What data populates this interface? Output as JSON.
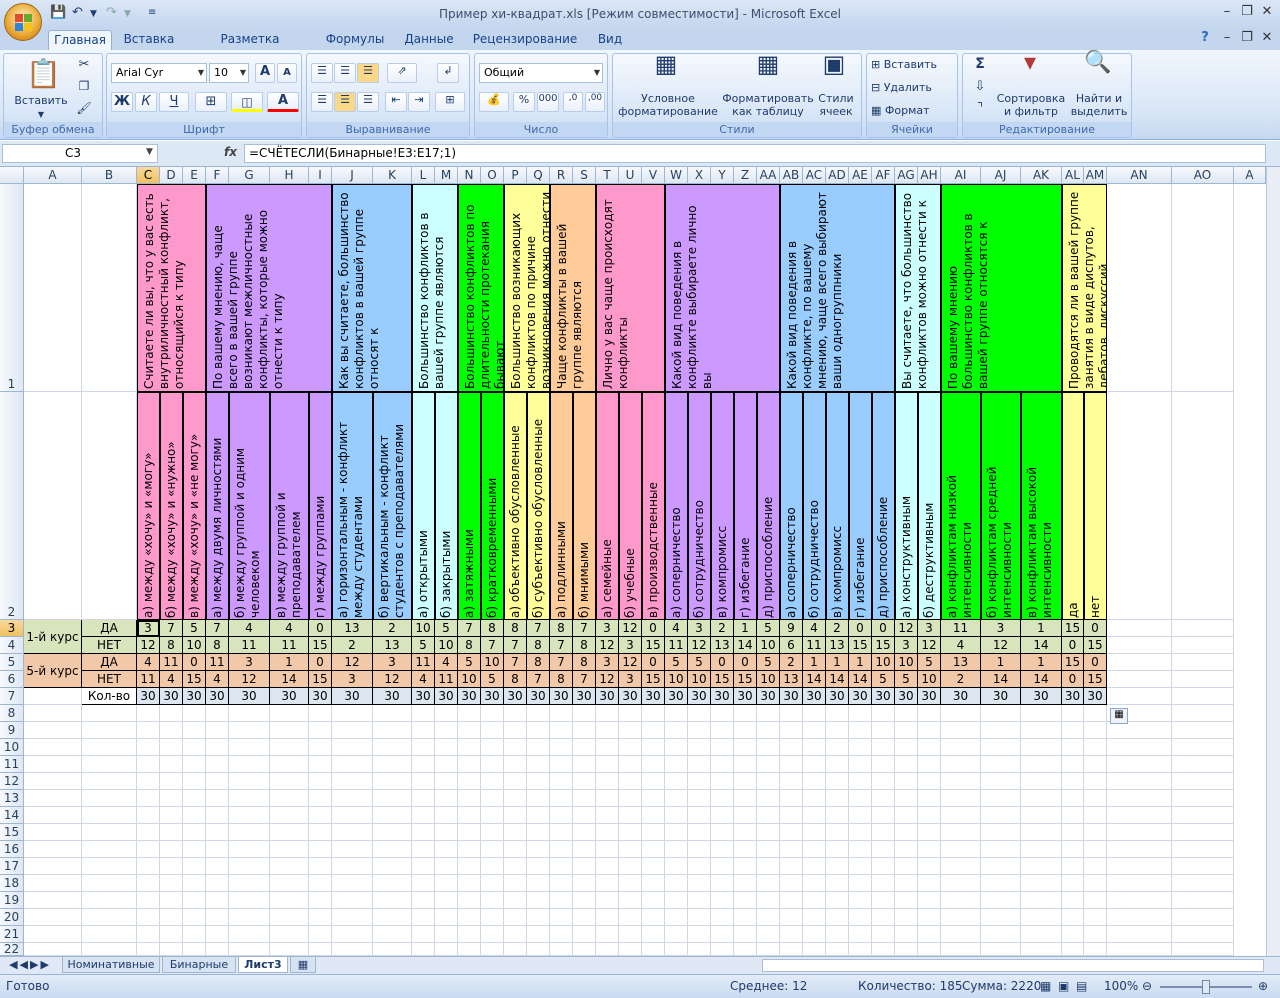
{
  "window": {
    "title": "Пример хи-квадрат.xls  [Режим совместимости] - Microsoft Excel"
  },
  "tabs": [
    "Главная",
    "Вставка",
    "Разметка страницы",
    "Формулы",
    "Данные",
    "Рецензирование",
    "Вид"
  ],
  "ribbon": {
    "clipboard": {
      "label": "Буфер обмена",
      "paste": "Вставить"
    },
    "font": {
      "label": "Шрифт",
      "name": "Arial Cyr",
      "size": "10"
    },
    "alignment": {
      "label": "Выравнивание"
    },
    "number": {
      "label": "Число",
      "format": "Общий"
    },
    "styles": {
      "label": "Стили",
      "cond": "Условное форматирование",
      "table": "Форматировать как таблицу",
      "cell": "Стили ячеек"
    },
    "cells": {
      "label": "Ячейки",
      "insert": "Вставить",
      "delete": "Удалить",
      "format": "Формат"
    },
    "editing": {
      "label": "Редактирование",
      "sort": "Сортировка и фильтр",
      "find": "Найти и выделить"
    }
  },
  "namebox": "C3",
  "formula": "=СЧЁТЕСЛИ(Бинарные!E3:E17;1)",
  "columns": [
    "A",
    "B",
    "C",
    "D",
    "E",
    "F",
    "G",
    "H",
    "I",
    "J",
    "K",
    "L",
    "M",
    "N",
    "O",
    "P",
    "Q",
    "R",
    "S",
    "T",
    "U",
    "V",
    "W",
    "X",
    "Y",
    "Z",
    "AA",
    "AB",
    "AC",
    "AD",
    "AE",
    "AF",
    "AG",
    "AH",
    "AI",
    "AJ",
    "AK",
    "AL",
    "AM",
    "AN",
    "AO",
    "A"
  ],
  "rows": [
    "1",
    "2",
    "3",
    "4",
    "5",
    "6",
    "7",
    "8",
    "9",
    "10",
    "11",
    "12",
    "13",
    "14",
    "15",
    "16",
    "17",
    "18",
    "19",
    "20",
    "21",
    "22"
  ],
  "questions": [
    "Считаете ли вы, что у вас есть внутриличностный конфликт, относящийся к типу",
    "По вашему мнению, чаще всего в вашей группе возникают межличностные конфликты, которые можно отнести к типу",
    "Как вы считаете, большинство конфликтов в вашей группе относят к",
    "Большинство конфликтов в вашей группе являются",
    "Большинство конфликтов по длительности протекания бывают",
    "Большинство возникающих конфликтов по причине возникновения можно отнести",
    "Чаще конфликты в вашей группе являются",
    "Лично у вас чаще происходят конфликты",
    "Какой вид поведения в конфликте выбираете лично вы",
    "Какой вид поведения в конфликте, по вашему мнению, чаще всего выбирают ваши одногруппники",
    "Вы считаете, что большинство конфликтов можно отнести к",
    "По вашему мнению большинство конфликтов в вашей группе относятся к",
    "Проводятся ли в вашей группе занятия в виде диспутов, дебатов, дискуссий"
  ],
  "answers": [
    "а) между «хочу» и «могу»",
    "б) между «хочу» и «нужно»",
    "в) между «хочу» и «не могу»",
    "а) между двумя личностями",
    "б) между группой и одним человеком",
    "в) между группой и преподавателем",
    "г) между группами",
    "а) горизонтальным - конфликт между студентами",
    "б) вертикальным - конфликт студентов с преподавателями",
    "а) открытыми",
    "б) закрытыми",
    "а) затяжными",
    "б) кратковременными",
    "а) объективно обусловленные",
    "б) субъективно обусловленные",
    "а) подлинными",
    "б) мнимыми",
    "а) семейные",
    "б) учебные",
    "в) производственные",
    "а) соперничество",
    "б) сотрудничество",
    "в) компромисс",
    "г) избегание",
    "д) приспособление",
    "а) соперничество",
    "б) сотрудничество",
    "в) компромисс",
    "г) избегание",
    "д) приспособление",
    "а) конструктивным",
    "б) деструктивным",
    "а) конфликтам низкой интенсивности",
    "б) конфликтам средней интенсивности",
    "в) конфликтам высокой интенсивности",
    "да",
    "нет"
  ],
  "table": {
    "labels": {
      "course1": "1-й курс",
      "course5": "5-й курс",
      "yes": "ДА",
      "no": "НЕТ",
      "total": "Кол-во"
    },
    "r3": [
      3,
      7,
      5,
      7,
      4,
      4,
      0,
      13,
      2,
      10,
      5,
      7,
      8,
      8,
      7,
      8,
      7,
      3,
      12,
      0,
      4,
      3,
      2,
      1,
      5,
      9,
      4,
      2,
      0,
      0,
      12,
      3,
      11,
      3,
      1,
      15,
      0
    ],
    "r4": [
      12,
      8,
      10,
      8,
      11,
      11,
      15,
      2,
      13,
      5,
      10,
      8,
      7,
      7,
      8,
      7,
      8,
      12,
      3,
      15,
      11,
      12,
      13,
      14,
      10,
      6,
      11,
      13,
      15,
      15,
      3,
      12,
      4,
      12,
      14,
      0,
      15
    ],
    "r5": [
      4,
      11,
      0,
      11,
      3,
      1,
      0,
      12,
      3,
      11,
      4,
      5,
      10,
      7,
      8,
      7,
      8,
      3,
      12,
      0,
      5,
      5,
      0,
      0,
      5,
      2,
      1,
      1,
      1,
      10,
      10,
      5,
      13,
      1,
      1,
      15,
      0
    ],
    "r6": [
      11,
      4,
      15,
      4,
      12,
      14,
      15,
      3,
      12,
      4,
      11,
      10,
      5,
      8,
      7,
      8,
      7,
      12,
      3,
      15,
      10,
      10,
      15,
      15,
      10,
      13,
      14,
      14,
      14,
      5,
      5,
      10,
      2,
      14,
      14,
      0,
      15
    ],
    "r7": [
      30,
      30,
      30,
      30,
      30,
      30,
      30,
      30,
      30,
      30,
      30,
      30,
      30,
      30,
      30,
      30,
      30,
      30,
      30,
      30,
      30,
      30,
      30,
      30,
      30,
      30,
      30,
      30,
      30,
      30,
      30,
      30,
      30,
      30,
      30,
      30,
      30
    ]
  },
  "sheets": [
    "Номинативные",
    "Бинарные",
    "Лист3"
  ],
  "status": {
    "ready": "Готово",
    "avg": "Среднее: 12",
    "count": "Количество: 185",
    "sum": "Сумма: 2220",
    "zoom": "100%"
  },
  "colors": {
    "pink": "#ff99cc",
    "purple": "#cc99ff",
    "blue": "#99ccff",
    "cyan": "#ccffff",
    "green": "#00ff00",
    "yellow": "#ffff99",
    "orange": "#ffcc99",
    "row34": "#d8e4bc",
    "row56": "#f2c9a8",
    "row7": "#dce6f1"
  }
}
